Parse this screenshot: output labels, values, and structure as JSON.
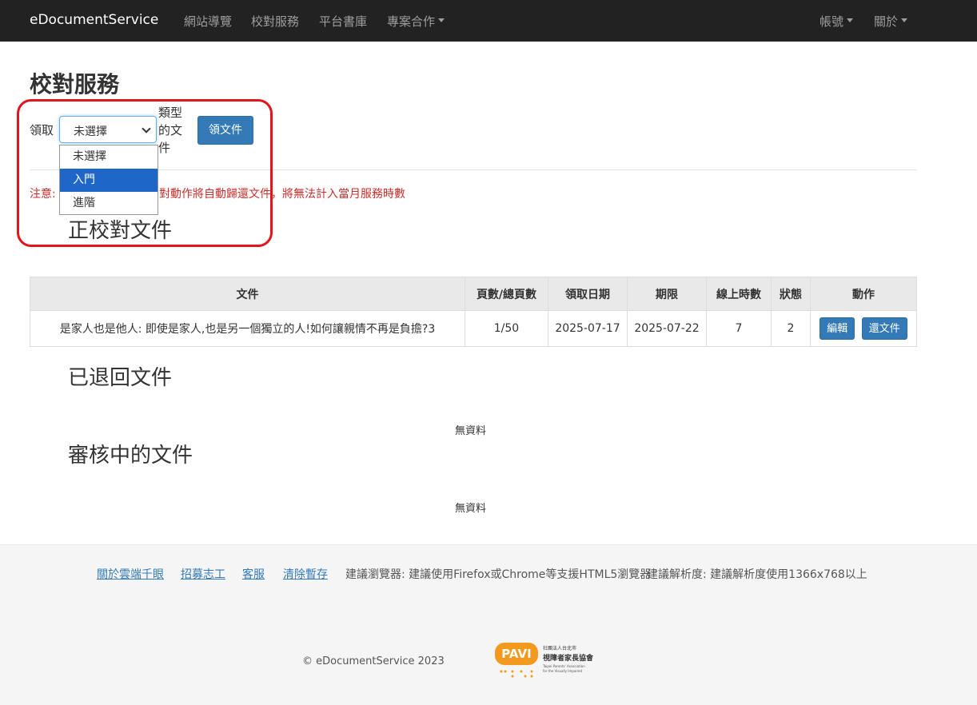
{
  "navbar": {
    "brand": "eDocumentService",
    "items": [
      "網站導覽",
      "校對服務",
      "平台書庫",
      "專案合作"
    ],
    "right_items": [
      "帳號",
      "關於"
    ]
  },
  "page": {
    "title": "校對服務"
  },
  "claim_form": {
    "label_prefix": "領取",
    "select_value": "未選擇",
    "label_suffix_1": "類型",
    "label_suffix_2": "的文",
    "label_suffix_3": "件",
    "options": [
      "未選擇",
      "入門",
      "進階"
    ],
    "highlighted_option": "入門",
    "button_label": "領文件"
  },
  "notice": {
    "start": "注意:",
    "rest": "對動作將自動歸還文件，將無法計入當月服務時數"
  },
  "sections": {
    "in_progress": "正校對文件",
    "returned": "已退回文件",
    "reviewing": "審核中的文件",
    "no_data": "無資料"
  },
  "table": {
    "headers": [
      "文件",
      "頁數/總頁數",
      "領取日期",
      "期限",
      "線上時數",
      "狀態",
      "動作"
    ],
    "rows": [
      {
        "title": "是家人也是他人: 即使是家人,也是另一個獨立的人!如何讓親情不再是負擔?3",
        "pages": "1/50",
        "claim_date": "2025-07-17",
        "deadline": "2025-07-22",
        "hours": "7",
        "status": "2",
        "edit": "編輯",
        "return": "還文件"
      }
    ]
  },
  "footer": {
    "links": [
      "關於雲端千眼",
      "招募志工",
      "客服",
      "清除暫存"
    ],
    "browser_note": "建議瀏覽器: 建議使用Firefox或Chrome等支援HTML5瀏覽器",
    "resolution_note": "建議解析度: 建議解析度使用1366x768以上",
    "copyright": "© eDocumentService 2023",
    "logo_text": "PAVI",
    "logo_org_1": "社團法人台北市",
    "logo_org_2": "視障者家長協會",
    "logo_en_1": "Taipei Parents' Association",
    "logo_en_2": "for the Visually Impaired"
  },
  "colors": {
    "navbar_bg": "#222222",
    "primary": "#337ab7",
    "notice": "#c9302c",
    "highlight": "#e2141c"
  }
}
